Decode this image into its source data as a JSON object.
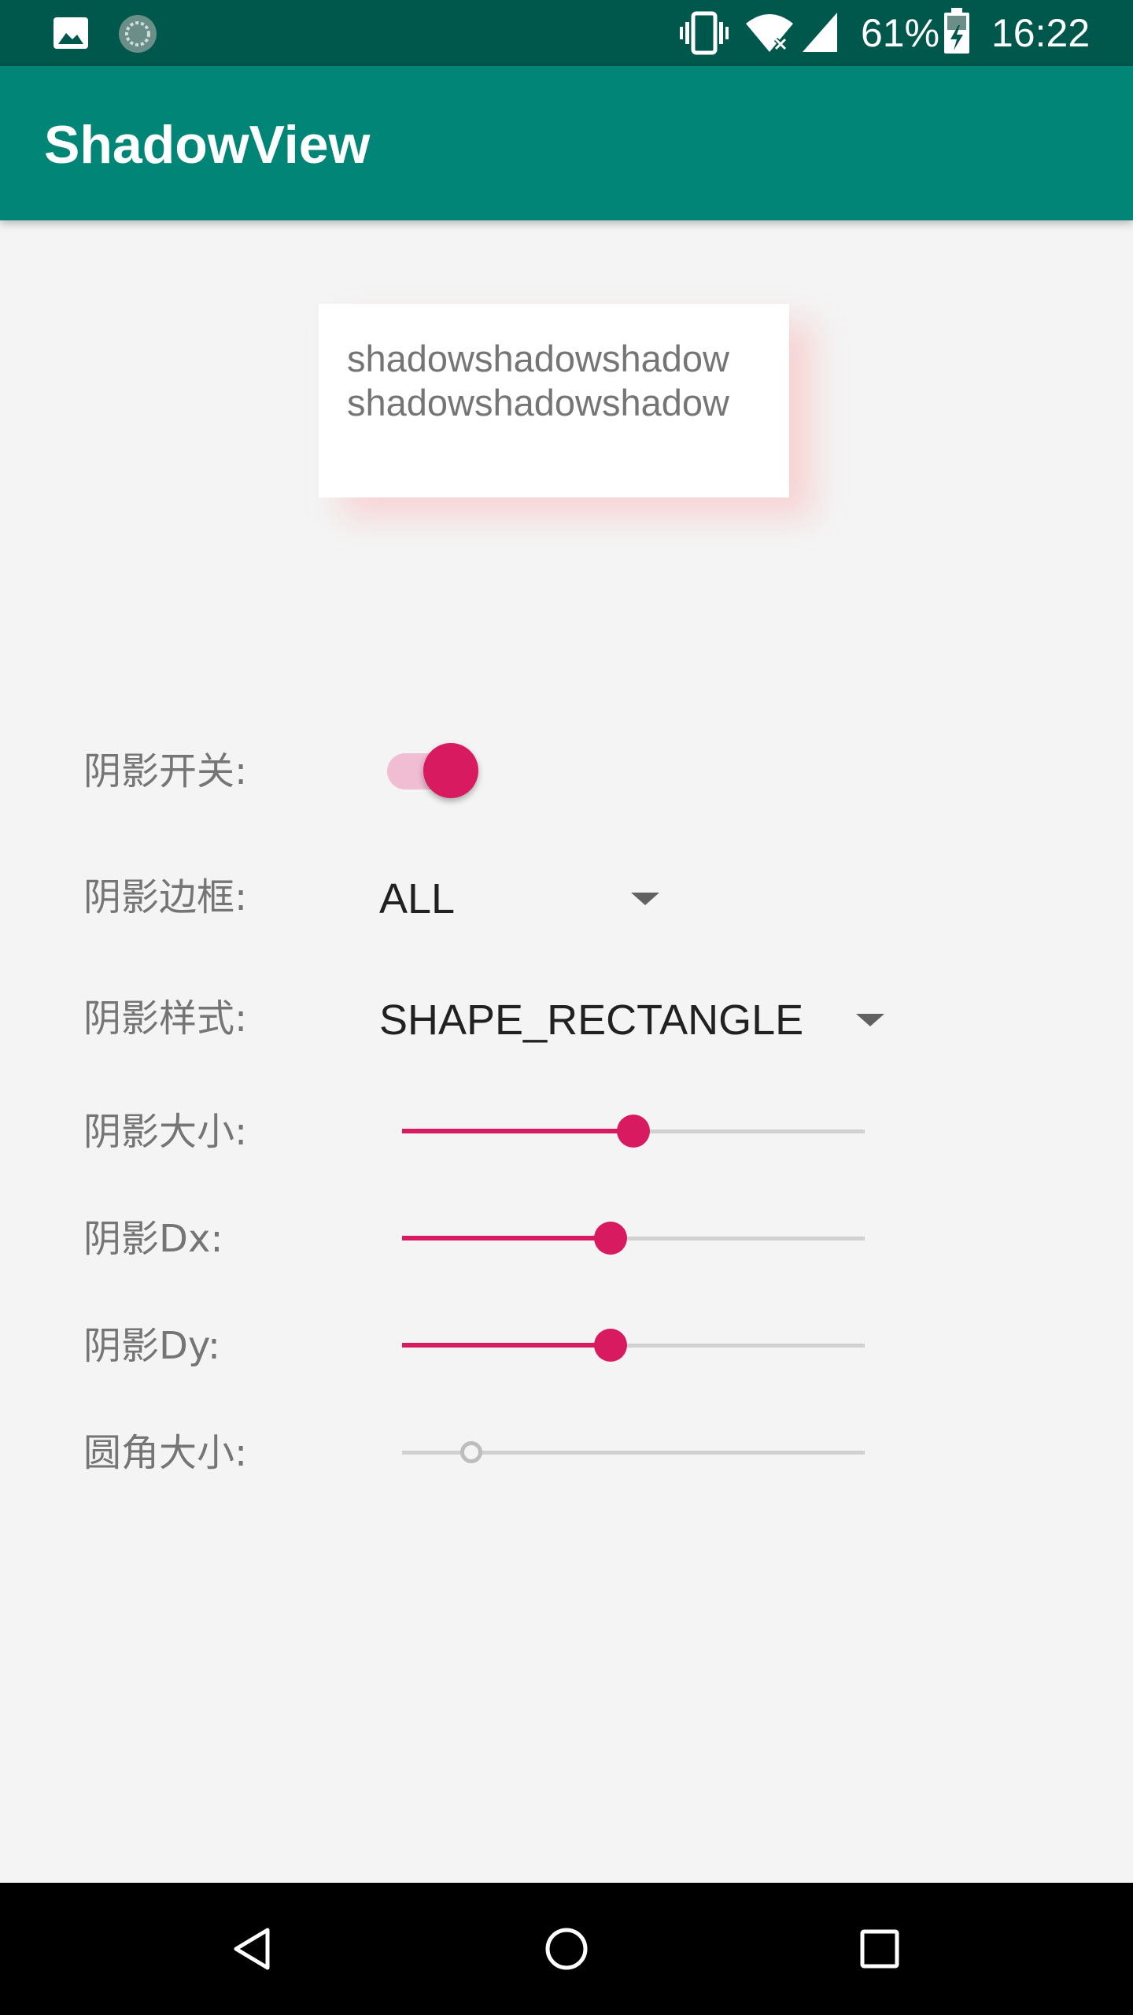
{
  "status_bar": {
    "battery": "61%",
    "time": "16:22",
    "icons": [
      "image-notification-icon",
      "sync-notification-icon",
      "vibrate-icon",
      "wifi-icon",
      "cell-signal-icon",
      "battery-charging-icon"
    ]
  },
  "app_bar": {
    "title": "ShadowView"
  },
  "demo_card": {
    "line1": "shadowshadowshadow",
    "line2": "shadowshadowshadow"
  },
  "settings": {
    "shadow_switch": {
      "label": "阴影开关:",
      "on": true
    },
    "shadow_border": {
      "label": "阴影边框:",
      "value": "ALL"
    },
    "shadow_style": {
      "label": "阴影样式:",
      "value": "SHAPE_RECTANGLE"
    },
    "shadow_size": {
      "label": "阴影大小:",
      "progress": 0.5
    },
    "shadow_dx": {
      "label": "阴影Dx:",
      "progress": 0.45
    },
    "shadow_dy": {
      "label": "阴影Dy:",
      "progress": 0.45
    },
    "corner_radius": {
      "label": "圆角大小:",
      "progress": 0.15
    }
  },
  "colors": {
    "status_bar": "#00574b",
    "app_bar": "#008577",
    "accent": "#d81b60",
    "background": "#f4f4f4"
  },
  "nav_bar": {
    "icons": [
      "back-icon",
      "home-icon",
      "recents-icon"
    ]
  }
}
